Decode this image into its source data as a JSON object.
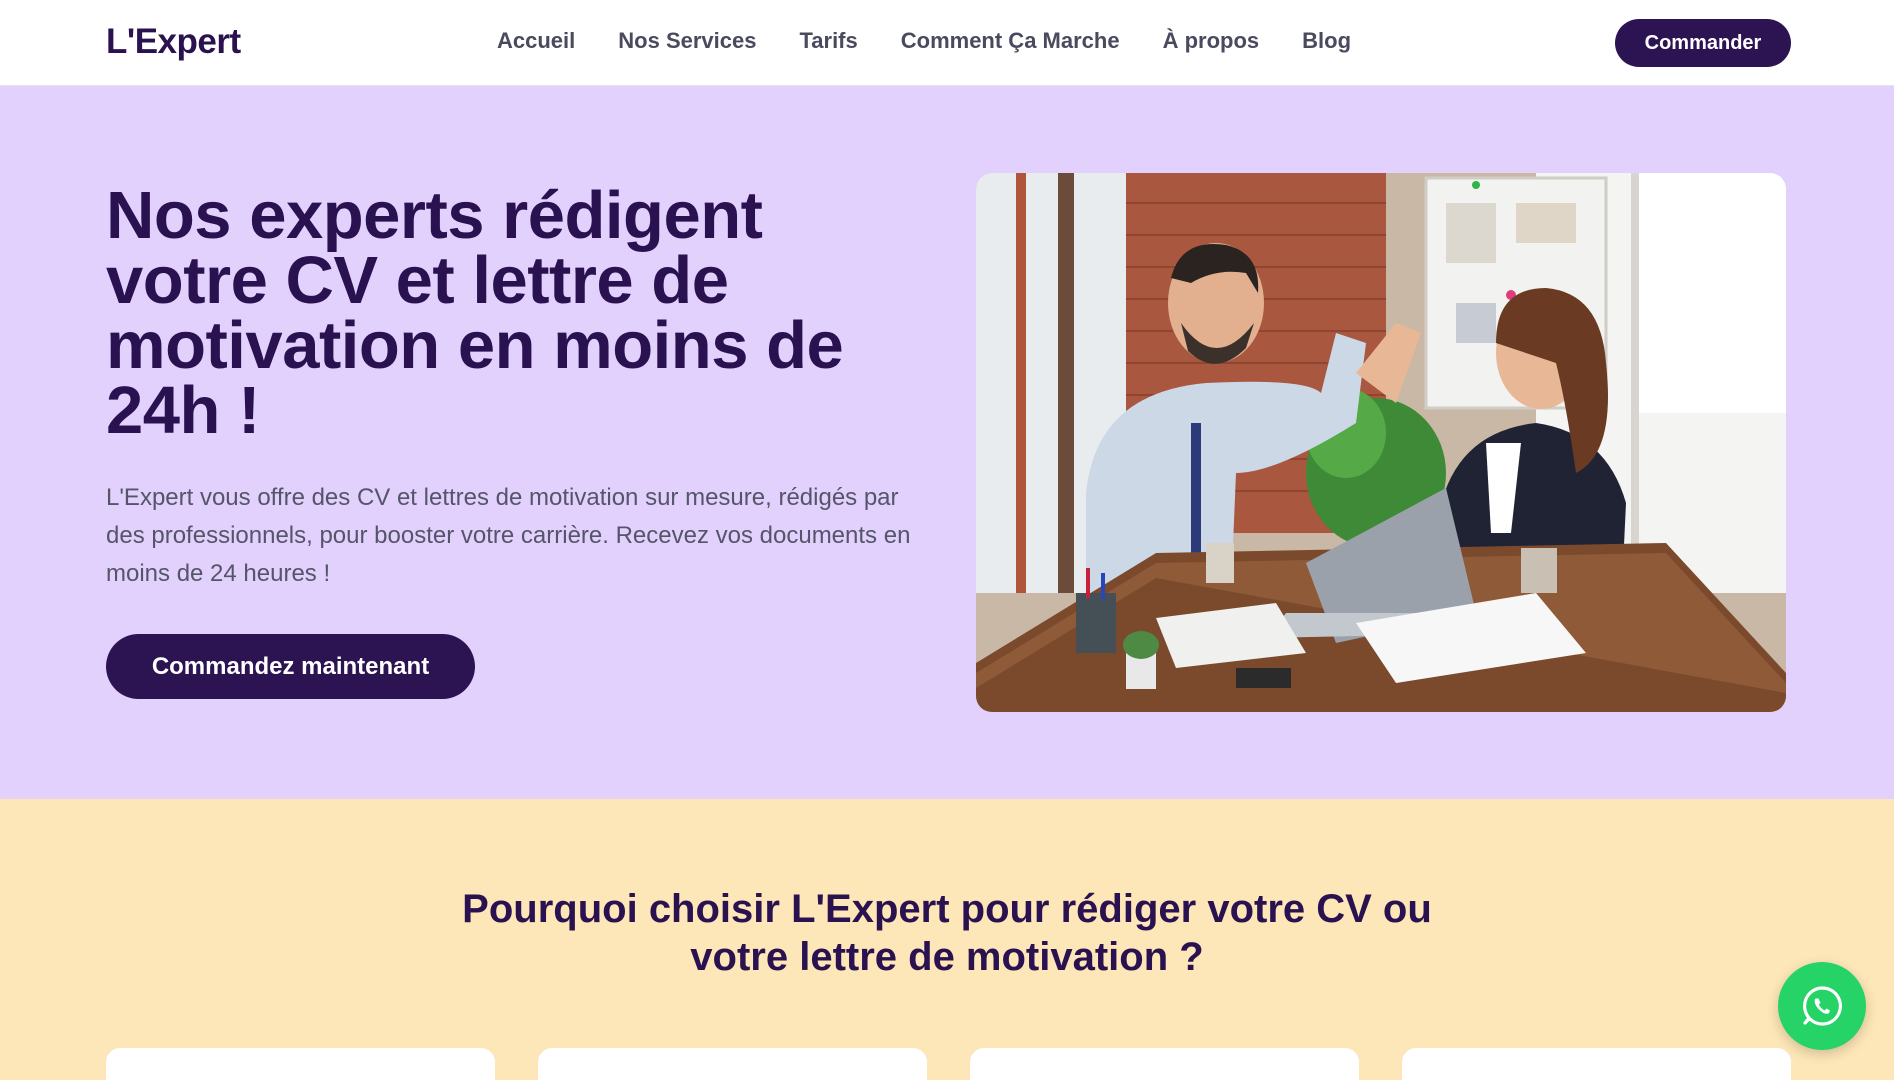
{
  "brand": {
    "name": "L'Expert"
  },
  "nav": {
    "links": [
      "Accueil",
      "Nos Services",
      "Tarifs",
      "Comment Ça Marche",
      "À propos",
      "Blog"
    ],
    "cta": "Commander"
  },
  "hero": {
    "title": "Nos experts rédigent votre CV et lettre de motivation en moins de 24h !",
    "text": "L'Expert vous offre des CV et lettres de motivation sur mesure, rédigés par des professionnels, pour booster votre carrière. Recevez vos documents en moins de 24 heures !",
    "cta": "Commandez maintenant",
    "image": "office-high-five-photo"
  },
  "why": {
    "title": "Pourquoi choisir L'Expert pour rédiger votre CV ou votre lettre de motivation ?"
  },
  "floating": {
    "icon": "whatsapp-icon"
  },
  "colors": {
    "primary": "#2c1352",
    "hero_bg": "#e3d1fd",
    "why_bg": "#fde6b7",
    "whatsapp": "#25d366"
  }
}
